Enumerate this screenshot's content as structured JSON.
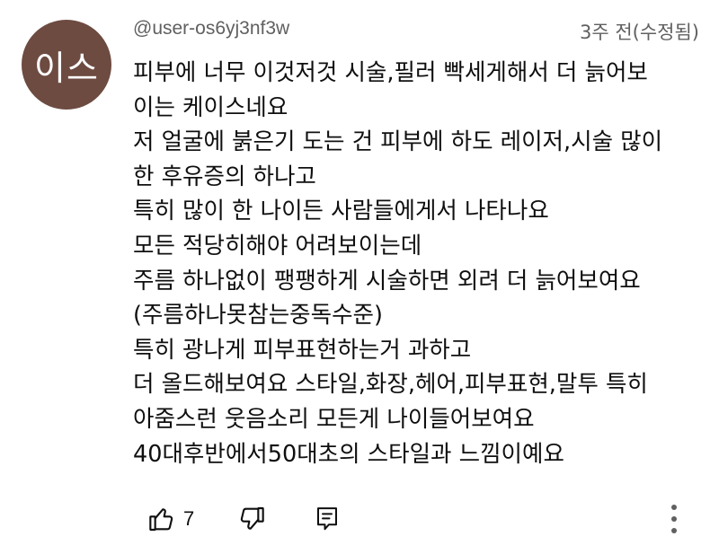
{
  "comment": {
    "avatar_initials": "이스",
    "avatar_color": "#6d4b41",
    "author": "@user-os6yj3nf3w",
    "timestamp": "3주 전(수정됨)",
    "lines": [
      "피부에 너무 이것저것 시술,필러 빡세게해서 더 늙어보",
      "이는 케이스네요",
      "저 얼굴에 붉은기 도는 건 피부에 하도 레이저,시술 많이",
      "한 후유증의 하나고",
      "특히  많이 한 나이든 사람들에게서 나타나요",
      "모든  적당히해야 어려보이는데",
      "주름 하나없이 팽팽하게 시술하면 외려 더 늙어보여요",
      "(주름하나못참는중독수준)",
      "특히 광나게 피부표현하는거 과하고",
      "더 올드해보여요 스타일,화장,헤어,피부표현,말투  특히",
      "아줌스런 웃음소리 모든게 나이들어보여요",
      "40대후반에서50대초의 스타일과 느낌이예요"
    ],
    "actions": {
      "like_icon": "thumbs-up-icon",
      "like_count": "7",
      "dislike_icon": "thumbs-down-icon",
      "reply_icon": "reply-icon",
      "more_icon": "more-vertical-icon"
    }
  }
}
